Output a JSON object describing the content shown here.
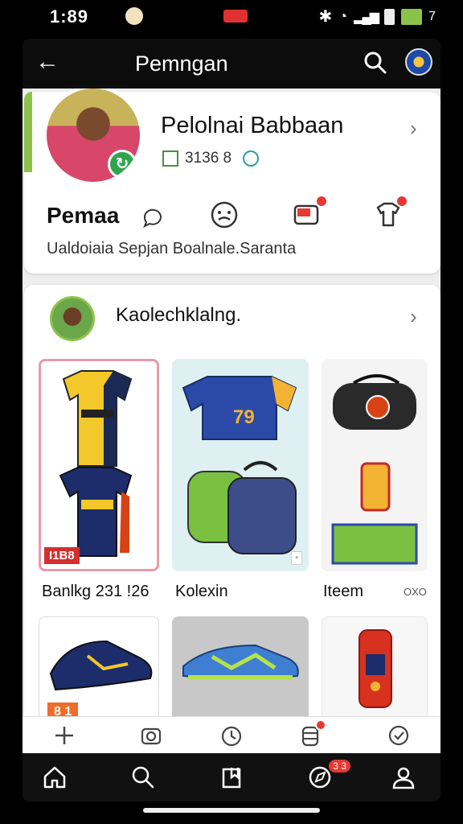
{
  "status_bar": {
    "time": "1:89",
    "extra": "7"
  },
  "app_bar": {
    "title": "Pemngan"
  },
  "profile": {
    "name": "Pelolnai Babbaan",
    "stat": "3136 8",
    "label": "Pemaa",
    "subtitle": "Ualdoiaia Sepjan Boalnale.Saranta"
  },
  "collection": {
    "title": "Kaolechklalng.",
    "tiles": [
      {
        "caption": "Banlkg 231 !26",
        "tag": "I1B8"
      },
      {
        "caption": "Kolexin",
        "jersey_number": "79"
      },
      {
        "caption": "Iteem",
        "meta": "OXO"
      }
    ],
    "row2_tag": "8 1"
  },
  "bottom_nav": {
    "badge": "3 3"
  },
  "colors": {
    "accent_green": "#8bc34a",
    "badge_red": "#e53935",
    "bar_dark": "#0c0c0c"
  },
  "icons": [
    "back-arrow-icon",
    "search-icon",
    "club-crest-icon",
    "chevron-right-icon",
    "home-icon",
    "profile-icon"
  ]
}
